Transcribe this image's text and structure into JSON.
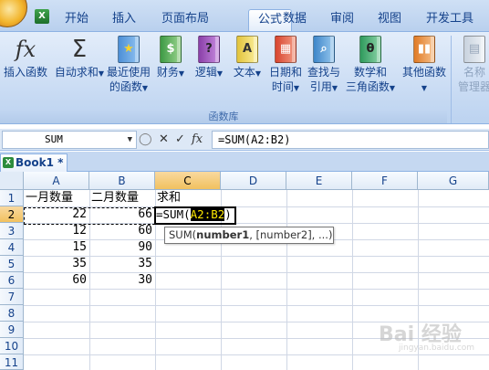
{
  "ribbon_tabs": [
    "开始",
    "插入",
    "页面布局",
    "公式",
    "数据",
    "审阅",
    "视图",
    "开发工具"
  ],
  "active_tab": "公式",
  "buttons": {
    "insert_function": "插入函数",
    "autosum_l1": "自动求和",
    "recent_l1": "最近使用",
    "recent_l2": "的函数",
    "financial": "财务",
    "logical": "逻辑",
    "text": "文本",
    "datetime_l1": "日期和",
    "datetime_l2": "时间",
    "lookup_l1": "查找与",
    "lookup_l2": "引用",
    "math_l1": "数学和",
    "math_l2": "三角函数",
    "more": "其他函数",
    "name_mgr_l1": "名称",
    "name_mgr_l2": "管理器"
  },
  "icons": {
    "insert_function": "fx",
    "autosum": "Σ",
    "logical": "?",
    "text": "A",
    "math": "θ"
  },
  "group_label": "函数库",
  "formula_bar": {
    "name_box": "SUM",
    "fx_symbol": "fx",
    "formula": "=SUM(A2:B2)"
  },
  "workbook_tab": "Book1 *",
  "columns": [
    "A",
    "B",
    "C",
    "D",
    "E",
    "F",
    "G"
  ],
  "rows": [
    "1",
    "2",
    "3",
    "4",
    "5",
    "6",
    "7",
    "8",
    "9",
    "10",
    "11"
  ],
  "cells": {
    "A1": "一月数量",
    "B1": "二月数量",
    "C1": "求和",
    "A2": "22",
    "B2": "66",
    "A3": "12",
    "B3": "60",
    "A4": "15",
    "B4": "90",
    "A5": "35",
    "B5": "35",
    "A6": "60",
    "B6": "30"
  },
  "cell_edit": {
    "prefix": "=SUM(",
    "ref": "A2:B2",
    "suffix": ")"
  },
  "tooltip": {
    "fn": "SUM(",
    "arg1": "number1",
    "rest": ", [number2], ...)"
  },
  "watermark": {
    "main": "Bai 经验",
    "sub": "jingyan.baidu.com"
  },
  "colors": {
    "ribbon": "#dbe7f7",
    "accent": "#15428b",
    "selected_header": "#f1c15f"
  }
}
